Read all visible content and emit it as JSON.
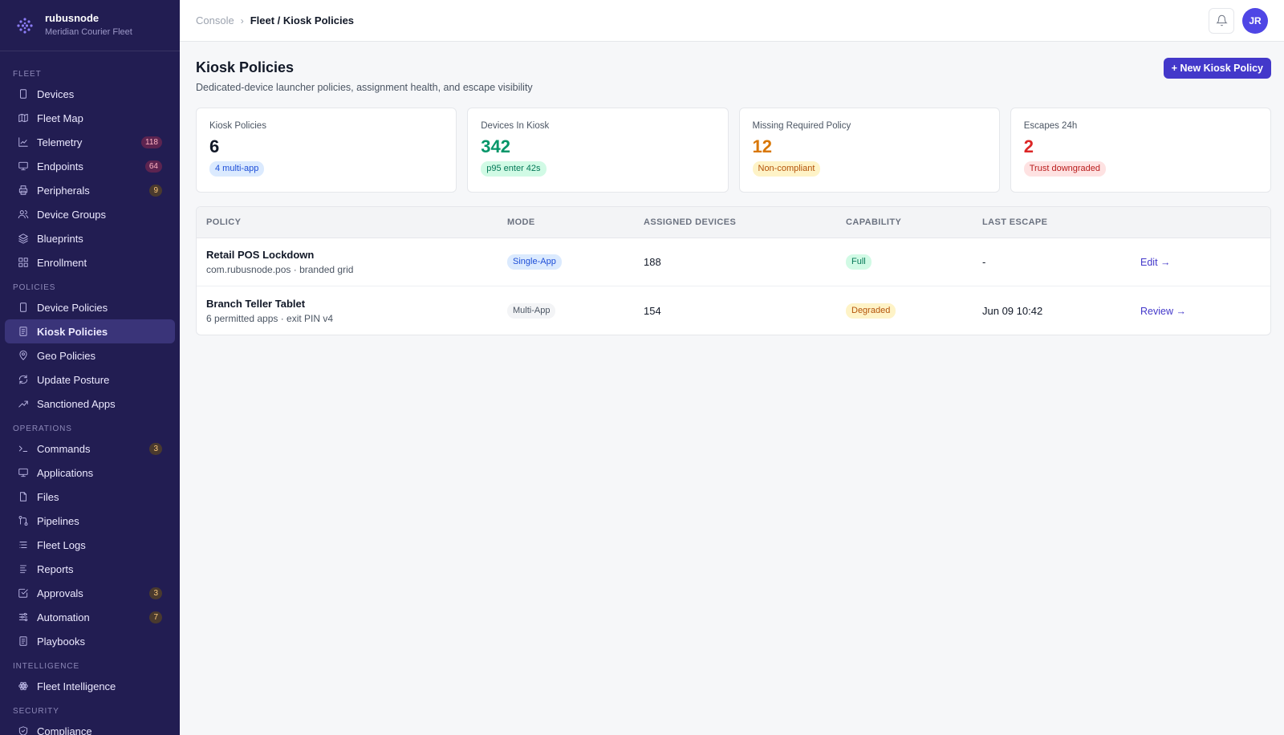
{
  "brand": {
    "name": "rubusnode",
    "subtitle": "Meridian Courier Fleet"
  },
  "sidebar": {
    "sections": [
      {
        "title": "FLEET",
        "items": [
          {
            "label": "Devices",
            "icon": "device-icon",
            "badge": ""
          },
          {
            "label": "Fleet Map",
            "icon": "map-icon",
            "badge": ""
          },
          {
            "label": "Telemetry",
            "icon": "chart-icon",
            "badge": "118"
          },
          {
            "label": "Endpoints",
            "icon": "monitor-icon",
            "badge": "64"
          },
          {
            "label": "Peripherals",
            "icon": "printer-icon",
            "badge": "9"
          },
          {
            "label": "Device Groups",
            "icon": "users-icon",
            "badge": ""
          },
          {
            "label": "Blueprints",
            "icon": "layers-icon",
            "badge": ""
          },
          {
            "label": "Enrollment",
            "icon": "grid-icon",
            "badge": ""
          }
        ]
      },
      {
        "title": "POLICIES",
        "items": [
          {
            "label": "Device Policies",
            "icon": "device-icon",
            "badge": ""
          },
          {
            "label": "Kiosk Policies",
            "icon": "document-icon",
            "badge": "",
            "active": true
          },
          {
            "label": "Geo Policies",
            "icon": "pin-icon",
            "badge": ""
          },
          {
            "label": "Update Posture",
            "icon": "refresh-icon",
            "badge": ""
          },
          {
            "label": "Sanctioned Apps",
            "icon": "trend-icon",
            "badge": ""
          }
        ]
      },
      {
        "title": "OPERATIONS",
        "items": [
          {
            "label": "Commands",
            "icon": "terminal-icon",
            "badge": "3"
          },
          {
            "label": "Applications",
            "icon": "monitor-icon",
            "badge": ""
          },
          {
            "label": "Files",
            "icon": "file-icon",
            "badge": ""
          },
          {
            "label": "Pipelines",
            "icon": "pipeline-icon",
            "badge": ""
          },
          {
            "label": "Fleet Logs",
            "icon": "list-icon",
            "badge": ""
          },
          {
            "label": "Reports",
            "icon": "lines-icon",
            "badge": ""
          },
          {
            "label": "Approvals",
            "icon": "check-square-icon",
            "badge": "3"
          },
          {
            "label": "Automation",
            "icon": "sliders-icon",
            "badge": "7"
          },
          {
            "label": "Playbooks",
            "icon": "document-icon",
            "badge": ""
          }
        ]
      },
      {
        "title": "INTELLIGENCE",
        "items": [
          {
            "label": "Fleet Intelligence",
            "icon": "atom-icon",
            "badge": ""
          }
        ]
      },
      {
        "title": "SECURITY",
        "items": [
          {
            "label": "Compliance",
            "icon": "shield-icon",
            "badge": ""
          }
        ]
      }
    ]
  },
  "topbar": {
    "crumb_root": "Console",
    "crumb_separator": "›",
    "crumb_current": "Fleet / Kiosk Policies",
    "avatar_initials": "JR"
  },
  "page": {
    "title": "Kiosk Policies",
    "subtitle": "Dedicated-device launcher policies, assignment health, and escape visibility",
    "new_button": "+ New Kiosk Policy"
  },
  "stats": [
    {
      "label": "Kiosk Policies",
      "value": "6",
      "pill": "4 multi-app",
      "tone": "dark",
      "pill_tone": "blue"
    },
    {
      "label": "Devices In Kiosk",
      "value": "342",
      "pill": "p95 enter 42s",
      "tone": "green",
      "pill_tone": "green"
    },
    {
      "label": "Missing Required Policy",
      "value": "12",
      "pill": "Non-compliant",
      "tone": "amber",
      "pill_tone": "amber"
    },
    {
      "label": "Escapes 24h",
      "value": "2",
      "pill": "Trust downgraded",
      "tone": "red",
      "pill_tone": "red"
    }
  ],
  "table": {
    "headers": [
      "POLICY",
      "MODE",
      "ASSIGNED DEVICES",
      "CAPABILITY",
      "LAST ESCAPE"
    ],
    "rows": [
      {
        "name": "Retail POS Lockdown",
        "desc": "com.rubusnode.pos · branded grid",
        "mode": "Single-App",
        "mode_tone": "blue",
        "assigned": "188",
        "capability": "Full",
        "cap_tone": "green",
        "last_escape": "-",
        "action": "Edit →"
      },
      {
        "name": "Branch Teller Tablet",
        "desc": "6 permitted apps · exit PIN v4",
        "mode": "Multi-App",
        "mode_tone": "gray",
        "assigned": "154",
        "capability": "Degraded",
        "cap_tone": "amber",
        "last_escape": "Jun 09 10:42",
        "action": "Review →"
      }
    ]
  },
  "colors": {
    "sidebar_bg": "#221d52",
    "accent": "#4338ca",
    "active_item": "#3a3479"
  }
}
